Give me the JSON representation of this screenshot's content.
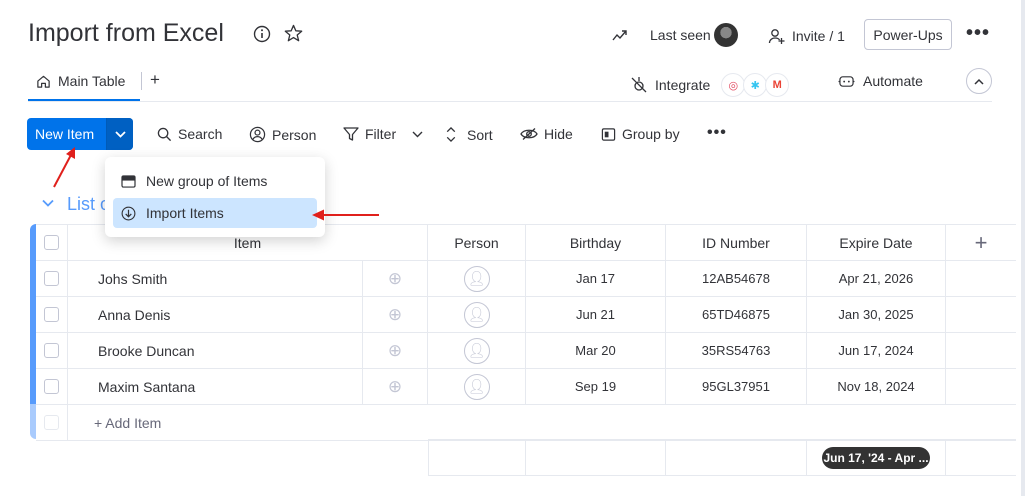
{
  "header": {
    "title": "Import from Excel",
    "last_seen_label": "Last seen",
    "invite_label": "Invite / 1",
    "powerups_label": "Power-Ups"
  },
  "tabs": {
    "main_table_label": "Main Table",
    "add_label": "+"
  },
  "integrations": {
    "integrate_label": "Integrate",
    "automate_label": "Automate",
    "apps": [
      "monday",
      "slack",
      "gmail"
    ]
  },
  "toolbar": {
    "new_item_label": "New Item",
    "search_label": "Search",
    "person_label": "Person",
    "filter_label": "Filter",
    "sort_label": "Sort",
    "hide_label": "Hide",
    "group_by_label": "Group by"
  },
  "new_item_menu": {
    "items": [
      {
        "label": "New group of Items",
        "icon": "group-icon"
      },
      {
        "label": "Import Items",
        "icon": "download-icon",
        "highlighted": true
      }
    ]
  },
  "group": {
    "title": "List of Items",
    "accent_color": "#579bfc"
  },
  "table": {
    "columns": [
      "Item",
      "Person",
      "Birthday",
      "ID Number",
      "Expire Date"
    ],
    "rows": [
      {
        "item": "Johs Smith",
        "birthday": "Jan 17",
        "id_number": "12AB54678",
        "expire_date": "Apr 21, 2026"
      },
      {
        "item": "Anna Denis",
        "birthday": "Jun 21",
        "id_number": "65TD46875",
        "expire_date": "Jan 30, 2025"
      },
      {
        "item": "Brooke Duncan",
        "birthday": "Mar 20",
        "id_number": "35RS54763",
        "expire_date": "Jun 17, 2024"
      },
      {
        "item": "Maxim Santana",
        "birthday": "Sep 19",
        "id_number": "95GL37951",
        "expire_date": "Nov 18, 2024"
      }
    ],
    "add_item_label": "+ Add Item",
    "expire_summary": "Jun 17, '24 - Apr ..."
  },
  "colors": {
    "primary": "#0073ea",
    "highlight": "#cce5ff",
    "annotation_arrow": "#e0201c"
  }
}
